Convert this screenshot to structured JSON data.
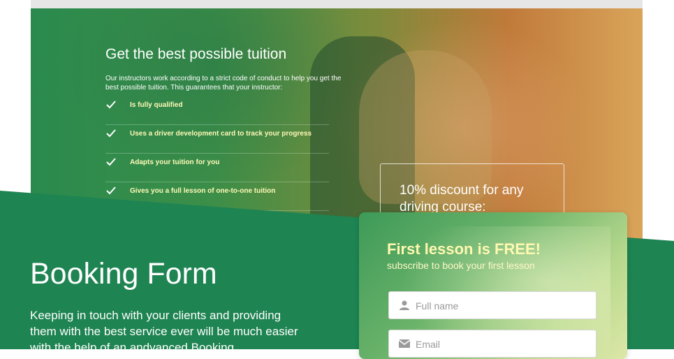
{
  "hero": {
    "title": "Get the best possible tuition",
    "intro": "Our instructors work according to a strict code of conduct to help you get the best possible tuition. This guarantees that your instructor:",
    "checklist": [
      "Is fully qualified",
      "Uses a driver development card to track your progress",
      "Adapts your tuition for you",
      "Gives you a full lesson of one-to-one tuition"
    ],
    "discount": "10% discount for any driving course:"
  },
  "booking": {
    "title": "Booking Form",
    "description": "Keeping in touch with your clients and providing them with the best service ever will be much easier with the help of an andvanced Booking"
  },
  "form": {
    "heading": "First lesson is FREE!",
    "subheading": "subscribe to book your first lesson",
    "fullname_placeholder": "Full name",
    "email_placeholder": "Email"
  },
  "colors": {
    "band_green": "#1e8452",
    "check_color": "#ffffff",
    "highlight_yellow": "#fff8b0"
  },
  "icons": {
    "check": "check-icon",
    "user": "user-icon",
    "email": "envelope-icon"
  }
}
